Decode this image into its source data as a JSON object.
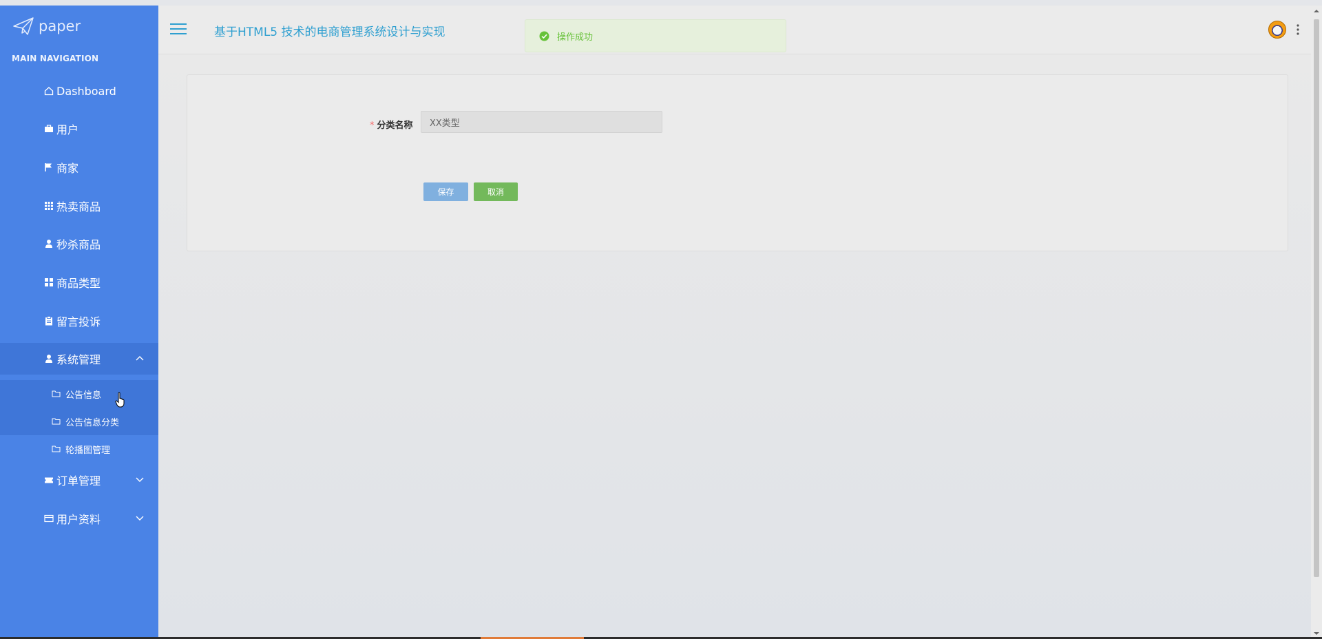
{
  "brand": {
    "name": "paper"
  },
  "sidebar": {
    "header": "MAIN NAVIGATION",
    "items": [
      {
        "label": "Dashboard",
        "icon": "home-icon"
      },
      {
        "label": "用户",
        "icon": "briefcase-icon"
      },
      {
        "label": "商家",
        "icon": "flag-icon"
      },
      {
        "label": "热卖商品",
        "icon": "grid-icon"
      },
      {
        "label": "秒杀商品",
        "icon": "user-icon"
      },
      {
        "label": "商品类型",
        "icon": "apps-icon"
      },
      {
        "label": "留言投诉",
        "icon": "clipboard-icon"
      },
      {
        "label": "系统管理",
        "icon": "user-icon",
        "expanded": true
      },
      {
        "label": "订单管理",
        "icon": "ticket-icon",
        "expanded": false
      },
      {
        "label": "用户资料",
        "icon": "card-icon",
        "expanded": false
      }
    ],
    "sub_items": [
      {
        "label": "公告信息",
        "icon": "folder-icon"
      },
      {
        "label": "公告信息分类",
        "icon": "folder-icon"
      },
      {
        "label": "轮播图管理",
        "icon": "folder-icon"
      }
    ]
  },
  "topbar": {
    "title": "基于HTML5 技术的电商管理系统设计与实现"
  },
  "toast": {
    "message": "操作成功",
    "type": "success"
  },
  "form": {
    "fields": [
      {
        "label": "分类名称",
        "required": true,
        "value": "XX类型"
      }
    ],
    "save_label": "保存",
    "cancel_label": "取消"
  },
  "colors": {
    "sidebar_bg": "#4a83e6",
    "title": "#2e9fd0",
    "success": "#67c23a",
    "save_btn": "#80b0df",
    "cancel_btn": "#73b95b",
    "required": "#f56c6c"
  }
}
